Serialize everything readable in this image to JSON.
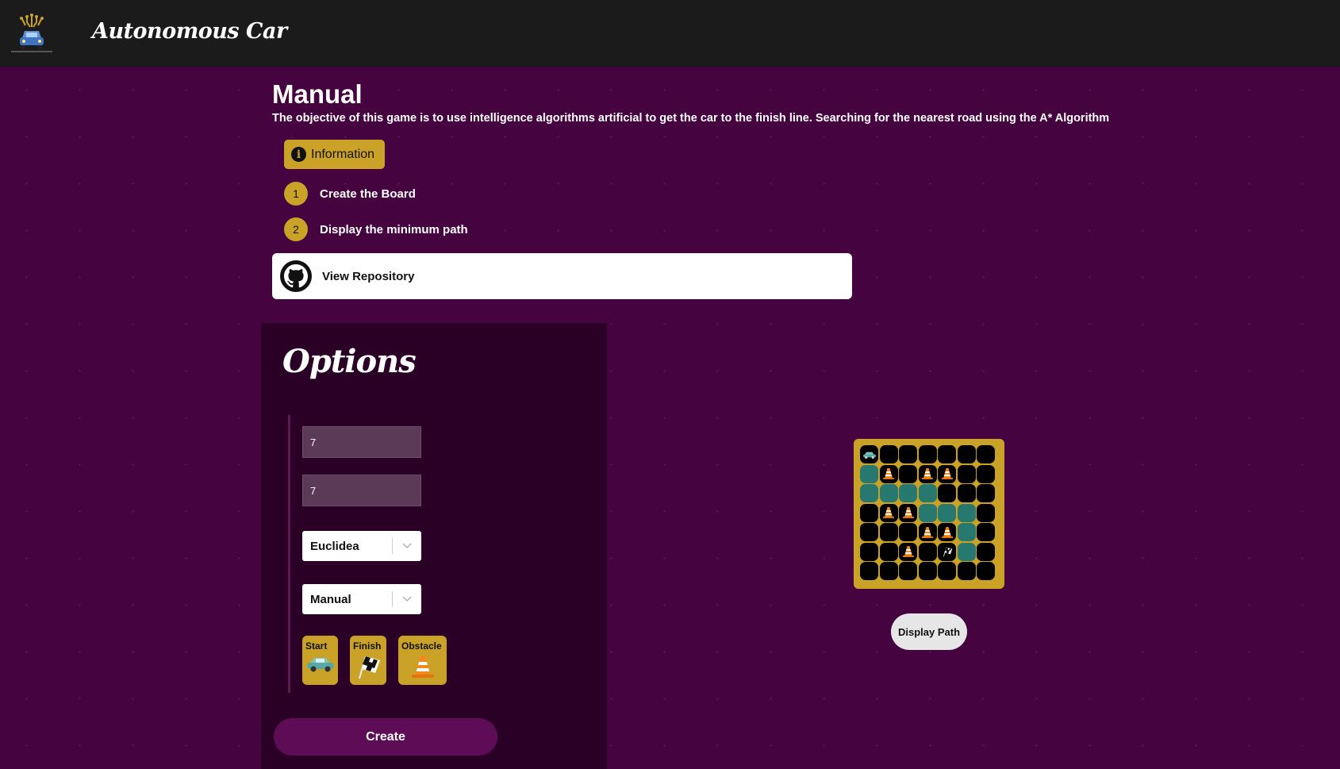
{
  "header": {
    "app_title": "Autonomous Car",
    "logo_icon": "autonomous-car-logo-icon"
  },
  "main": {
    "title": "Manual",
    "description": "The objective of this game is to use intelligence algorithms artificial to get the car to the finish line. Searching for the nearest road using the A* Algorithm",
    "info_button": {
      "label": "Information",
      "icon": "info-icon"
    },
    "steps": [
      {
        "number": "1",
        "label": "Create the Board"
      },
      {
        "number": "2",
        "label": "Display the minimum path"
      }
    ],
    "repo_button": {
      "label": "View Repository",
      "icon": "github-icon"
    }
  },
  "options": {
    "title": "Options",
    "rows_value": "7",
    "cols_value": "7",
    "heuristic_select": {
      "value": "Euclidea"
    },
    "mode_select": {
      "value": "Manual"
    },
    "pieces": [
      {
        "label": "Start",
        "icon": "car-icon"
      },
      {
        "label": "Finish",
        "icon": "checkered-flag-icon"
      },
      {
        "label": "Obstacle",
        "icon": "traffic-cone-icon"
      }
    ],
    "create_button": "Create"
  },
  "board": {
    "rows": 7,
    "cols": 7,
    "legend": {
      "E": "empty",
      "R": "road-path",
      "S": "start",
      "F": "finish",
      "O": "obstacle"
    },
    "cells": [
      "SEEEEEE",
      "ROEOOEE",
      "RRRREEE",
      "EOORRRE",
      "EEEOORE",
      "EEOEFRE",
      "EEEEEEE"
    ],
    "display_button": "Display Path"
  },
  "colors": {
    "background": "#450440",
    "topbar": "#1b1b1b",
    "accent_gold": "#c9a227",
    "panel": "#2a0026",
    "create_button": "#5e0c56",
    "road_cell": "#27786f",
    "empty_cell": "#000000"
  }
}
